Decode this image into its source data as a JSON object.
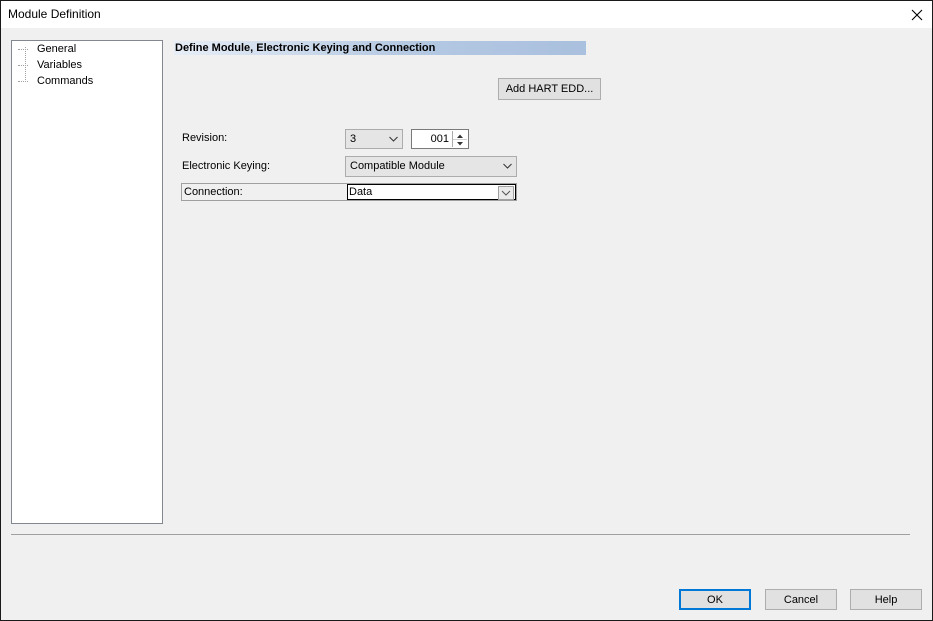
{
  "window": {
    "title": "Module Definition",
    "close_icon": "close-icon"
  },
  "tree": {
    "items": [
      {
        "label": "General"
      },
      {
        "label": "Variables"
      },
      {
        "label": "Commands"
      }
    ]
  },
  "section": {
    "title": "Define Module, Electronic Keying and Connection"
  },
  "add_hart_button": "Add HART EDD...",
  "revision": {
    "label": "Revision:",
    "major": "3",
    "minor": "001"
  },
  "keying": {
    "label": "Electronic Keying:",
    "value": "Compatible Module"
  },
  "connection": {
    "label": "Connection:",
    "value": "Data"
  },
  "buttons": {
    "ok": "OK",
    "cancel": "Cancel",
    "help": "Help"
  },
  "colors": {
    "accent": "#0078d7",
    "header_band": "#a9c0de"
  }
}
